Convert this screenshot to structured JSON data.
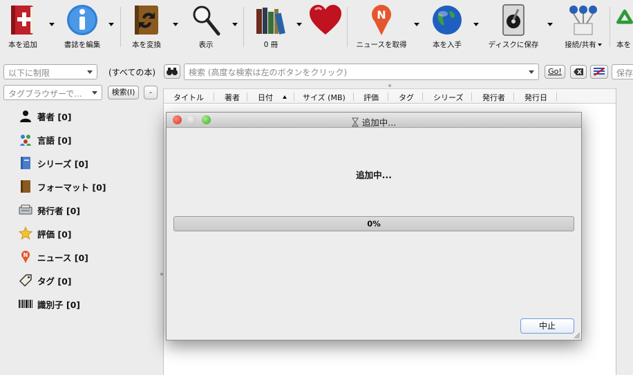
{
  "toolbar": {
    "add_books": "本を追加",
    "edit_metadata": "書誌を編集",
    "convert": "本を変換",
    "view": "表示",
    "library_count": "0 冊",
    "fetch_news": "ニュースを取得",
    "get_books": "本を入手",
    "save_to_disk": "ディスクに保存",
    "connect_share": "接続/共有",
    "overflow": "本を"
  },
  "search": {
    "restrict_placeholder": "以下に制限",
    "all_books": "(すべての本)",
    "search_placeholder": "検索 (高度な検索は左のボタンをクリック)",
    "go": "Go!",
    "save_placeholder": "保存"
  },
  "tag_browser": {
    "filter_placeholder": "タグブラウザーで...",
    "find_label": "検索(I)",
    "collapse_label": "-",
    "items": [
      {
        "label": "著者 [0]",
        "icon": "user-icon"
      },
      {
        "label": "言語 [0]",
        "icon": "languages-icon"
      },
      {
        "label": "シリーズ [0]",
        "icon": "series-icon"
      },
      {
        "label": "フォーマット [0]",
        "icon": "book-format-icon"
      },
      {
        "label": "発行者 [0]",
        "icon": "publisher-icon"
      },
      {
        "label": "評価 [0]",
        "icon": "star-icon"
      },
      {
        "label": "ニュース [0]",
        "icon": "news-icon"
      },
      {
        "label": "タグ [0]",
        "icon": "tag-icon"
      },
      {
        "label": "識別子 [0]",
        "icon": "barcode-icon"
      }
    ]
  },
  "columns": [
    "タイトル",
    "著者",
    "日付",
    "サイズ (MB)",
    "評価",
    "タグ",
    "シリーズ",
    "発行者",
    "発行日"
  ],
  "dialog": {
    "title": "追加中...",
    "message": "追加中...",
    "progress_text": "0%",
    "progress": 0,
    "cancel": "中止"
  },
  "colors": {
    "close": "#e2463f",
    "minimize": "#c9c9c9",
    "zoom": "#4fbf3a"
  }
}
